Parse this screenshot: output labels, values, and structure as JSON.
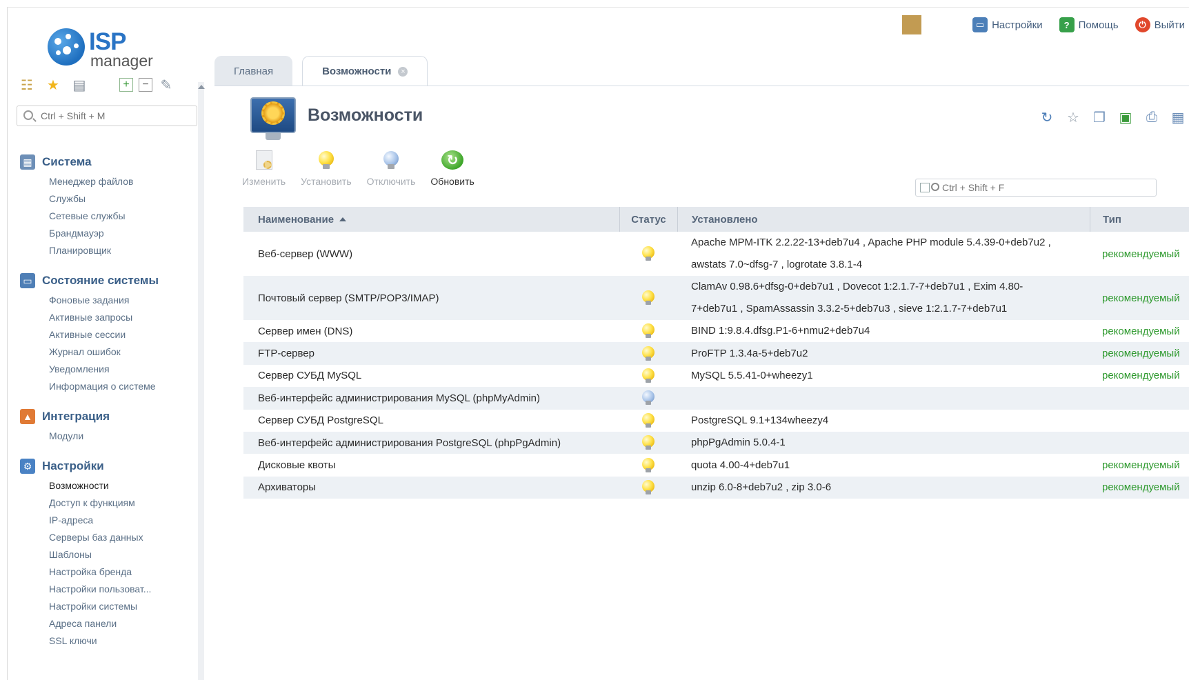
{
  "brand": {
    "logo_main": "ISP",
    "logo_sub": "manager"
  },
  "sidebar": {
    "search_placeholder": "Ctrl + Shift + M",
    "groups": [
      {
        "title": "Система",
        "icon": "system-icon",
        "items": [
          "Менеджер файлов",
          "Службы",
          "Сетевые службы",
          "Брандмауэр",
          "Планировщик"
        ]
      },
      {
        "title": "Состояние системы",
        "icon": "monitor-icon",
        "items": [
          "Фоновые задания",
          "Активные запросы",
          "Активные сессии",
          "Журнал ошибок",
          "Уведомления",
          "Информация о системе"
        ]
      },
      {
        "title": "Интеграция",
        "icon": "integration-icon",
        "items": [
          "Модули"
        ]
      },
      {
        "title": "Настройки",
        "icon": "settings-icon",
        "items": [
          "Возможности",
          "Доступ к функциям",
          "IP-адреса",
          "Серверы баз данных",
          "Шаблоны",
          "Настройка бренда",
          "Настройки пользоват...",
          "Настройки системы",
          "Адреса панели",
          "SSL ключи"
        ],
        "active": "Возможности"
      }
    ]
  },
  "topbar": {
    "settings": "Настройки",
    "help": "Помощь",
    "logout": "Выйти",
    "swatch_color": "#c29b52"
  },
  "tabs": {
    "home": "Главная",
    "features": "Возможности"
  },
  "page": {
    "title": "Возможности",
    "search_placeholder": "Ctrl + Shift + F",
    "actions": {
      "edit": "Изменить",
      "install": "Установить",
      "disable": "Отключить",
      "refresh": "Обновить"
    }
  },
  "table": {
    "headers": {
      "name": "Наименование",
      "status": "Статус",
      "installed": "Установлено",
      "type": "Тип"
    },
    "rows": [
      {
        "name": "Веб-сервер (WWW)",
        "status": "on",
        "installed": [
          "Apache MPM-ITK 2.2.22-13+deb7u4 , Apache PHP module 5.4.39-0+deb7u2 ,",
          "awstats 7.0~dfsg-7 , logrotate 3.8.1-4"
        ],
        "type": "рекомендуемый"
      },
      {
        "name": "Почтовый сервер (SMTP/POP3/IMAP)",
        "status": "on",
        "installed": [
          "ClamAv 0.98.6+dfsg-0+deb7u1 , Dovecot 1:2.1.7-7+deb7u1 , Exim 4.80-",
          "7+deb7u1 , SpamAssassin 3.3.2-5+deb7u3 , sieve 1:2.1.7-7+deb7u1"
        ],
        "type": "рекомендуемый"
      },
      {
        "name": "Сервер имен (DNS)",
        "status": "on",
        "installed": [
          "BIND 1:9.8.4.dfsg.P1-6+nmu2+deb7u4"
        ],
        "type": "рекомендуемый"
      },
      {
        "name": "FTP-сервер",
        "status": "on",
        "installed": [
          "ProFTP 1.3.4a-5+deb7u2"
        ],
        "type": "рекомендуемый"
      },
      {
        "name": "Сервер СУБД MySQL",
        "status": "on",
        "installed": [
          "MySQL 5.5.41-0+wheezy1"
        ],
        "type": "рекомендуемый"
      },
      {
        "name": "Веб-интерфейс администрирования MySQL (phpMyAdmin)",
        "status": "off",
        "installed": [
          ""
        ],
        "type": ""
      },
      {
        "name": "Сервер СУБД PostgreSQL",
        "status": "on",
        "installed": [
          "PostgreSQL 9.1+134wheezy4"
        ],
        "type": ""
      },
      {
        "name": "Веб-интерфейс администрирования PostgreSQL (phpPgAdmin)",
        "status": "on",
        "installed": [
          "phpPgAdmin 5.0.4-1"
        ],
        "type": ""
      },
      {
        "name": "Дисковые квоты",
        "status": "on",
        "installed": [
          "quota 4.00-4+deb7u1"
        ],
        "type": "рекомендуемый"
      },
      {
        "name": "Архиваторы",
        "status": "on",
        "installed": [
          "unzip 6.0-8+deb7u2 , zip 3.0-6"
        ],
        "type": "рекомендуемый"
      }
    ]
  },
  "colors": {
    "accent": "#3a5f88",
    "recommended": "#2f9a2f",
    "row_alt": "#edf1f5",
    "header_bg": "#e4e8ed"
  }
}
